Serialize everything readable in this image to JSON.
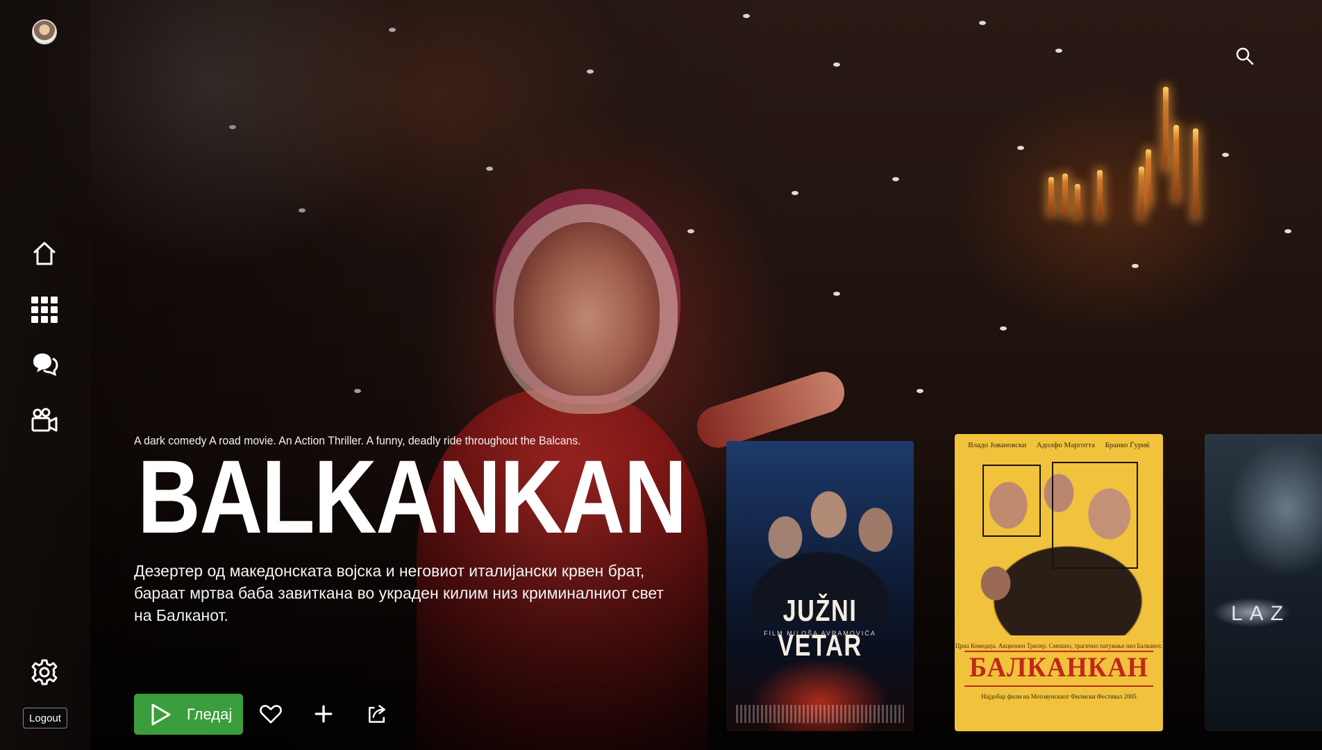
{
  "sidebar": {
    "avatar_label": "user avatar",
    "nav": [
      {
        "name": "home",
        "icon": "home-icon"
      },
      {
        "name": "apps",
        "icon": "grid-icon"
      },
      {
        "name": "chat",
        "icon": "chat-icon"
      },
      {
        "name": "movies",
        "icon": "camera-icon"
      }
    ],
    "settings_icon": "gear-icon",
    "logout_label": "Logout"
  },
  "header": {
    "search_icon": "search-icon"
  },
  "featured": {
    "tagline": "A dark comedy A road movie. An Action Thriller. A funny, deadly ride throughout the Balcans.",
    "title": "BALKANKAN",
    "description": "Дезертер од македонската војска и неговиот италијански крвен брат, бараат мртва баба завиткана во украден килим низ криминалниот свет на Балканот.",
    "play_label": "Гледај",
    "actions": [
      "heart-icon",
      "plus-icon",
      "share-icon"
    ]
  },
  "posters": [
    {
      "title": "JUŽNI VETAR",
      "subtitle": "FILM MILOŠA AVRAMOVIĆA"
    },
    {
      "cast": [
        "Владо Јовановски",
        "Адолфо Марготта",
        "Бранко Ѓуриќ"
      ],
      "tagline": "Црна Комедија. Акционен Трилер. Смешно, трагично патување низ Балканот.",
      "title": "БАЛКАНКАН",
      "award": "Најдобар филм на Мотовунскиот Филмски Фестивал 2005"
    },
    {
      "title": "LAZ"
    }
  ],
  "colors": {
    "play_button": "#3b9e3d",
    "poster_2_background": "#f1c23c",
    "poster_2_title": "#c0281c"
  }
}
